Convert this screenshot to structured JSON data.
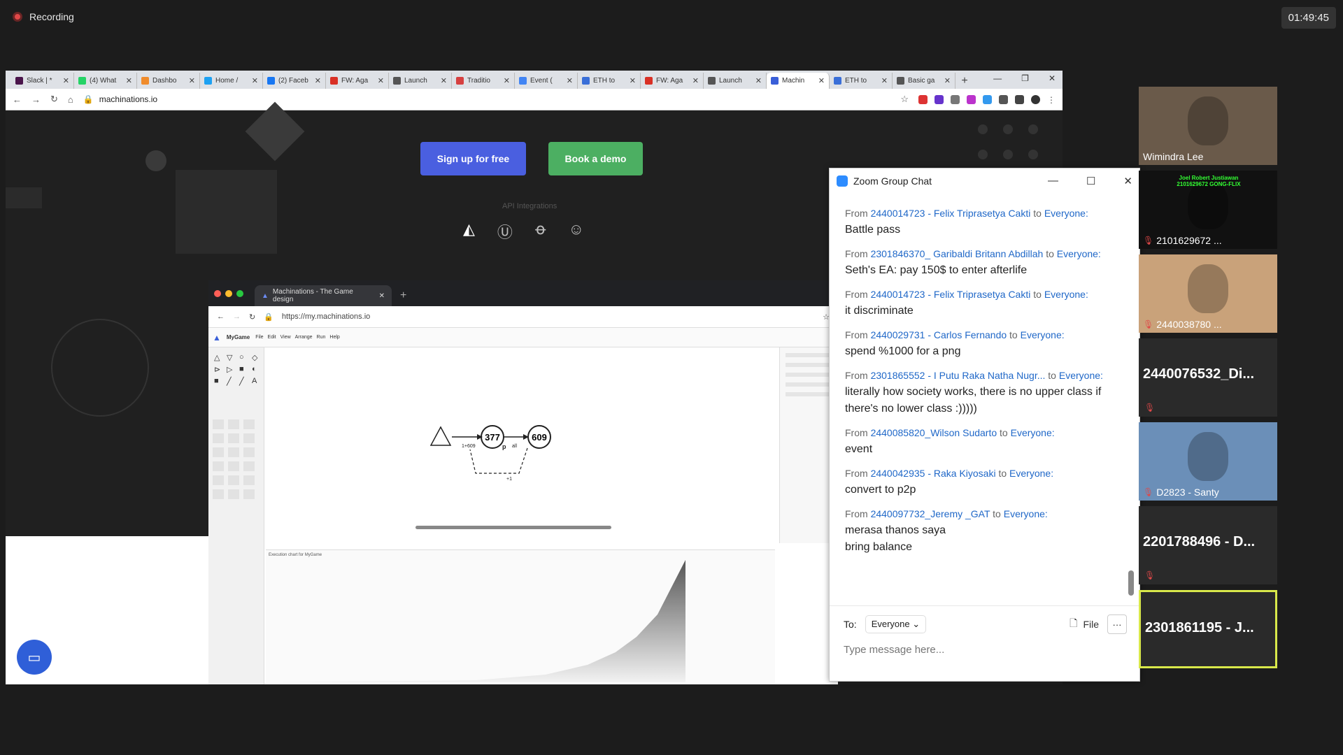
{
  "recording": {
    "label": "Recording"
  },
  "clock": "01:49:45",
  "browser": {
    "tabs": [
      {
        "label": "Slack | *",
        "color": "#4a154b"
      },
      {
        "label": "(4) What",
        "color": "#25d366"
      },
      {
        "label": "Dashbo",
        "color": "#f08c2c"
      },
      {
        "label": "Home /",
        "color": "#1da1f2"
      },
      {
        "label": "(2) Faceb",
        "color": "#1877f2"
      },
      {
        "label": "FW: Aga",
        "color": "#d93025"
      },
      {
        "label": "Launch",
        "color": "#555555"
      },
      {
        "label": "Traditio",
        "color": "#d64040"
      },
      {
        "label": "Event (",
        "color": "#4285f4"
      },
      {
        "label": "ETH to",
        "color": "#3a6fd8"
      },
      {
        "label": "FW: Aga",
        "color": "#d93025"
      },
      {
        "label": "Launch",
        "color": "#555555"
      },
      {
        "label": "Machin",
        "color": "#3a5fd8"
      },
      {
        "label": "ETH to",
        "color": "#3a6fd8"
      },
      {
        "label": "Basic ga",
        "color": "#555555"
      }
    ],
    "active_tab": 12,
    "url": "machinations.io"
  },
  "site": {
    "signup_label": "Sign up for free",
    "demo_label": "Book a demo",
    "api_label": "API Integrations"
  },
  "inner_browser": {
    "tab_title": "Machinations - The Game design",
    "url": "https://my.machinations.io",
    "diagram_title": "MyGame",
    "menu": [
      "File",
      "Edit",
      "View",
      "Arrange",
      "Run",
      "Help"
    ],
    "node_pool1": "377",
    "node_pool2": "609",
    "label_flow": "1+609",
    "label_p": "p",
    "label_all": "all",
    "label_plus1": "+1",
    "chart_title": "Execution chart for MyGame"
  },
  "zoom_chat": {
    "title": "Zoom Group Chat",
    "from_label": "From",
    "to_label": "to",
    "messages": [
      {
        "from": "2440014723 - Felix Triprasetya Cakti",
        "to": "Everyone:",
        "lines": [
          "Battle pass"
        ]
      },
      {
        "from": "2301846370_ Garibaldi Britann Abdillah",
        "to": "Everyone:",
        "lines": [
          "Seth's EA: pay 150$ to enter afterlife"
        ]
      },
      {
        "from": "2440014723 - Felix Triprasetya Cakti",
        "to": "Everyone:",
        "lines": [
          "it discriminate"
        ]
      },
      {
        "from": "2440029731 - Carlos Fernando",
        "to": "Everyone:",
        "lines": [
          "spend %1000 for a png"
        ]
      },
      {
        "from": "2301865552 - I Putu Raka Natha Nugr...",
        "to": "Everyone:",
        "lines": [
          "literally how society works, there is no upper class if there's no lower class :)))))"
        ]
      },
      {
        "from": "2440085820_Wilson Sudarto",
        "to": "Everyone:",
        "lines": [
          "event"
        ]
      },
      {
        "from": "2440042935 - Raka Kiyosaki",
        "to": "Everyone:",
        "lines": [
          "convert to p2p"
        ]
      },
      {
        "from": "2440097732_Jeremy _GAT",
        "to": "Everyone:",
        "lines": [
          "merasa thanos saya",
          "bring balance"
        ]
      }
    ],
    "to_field": "To:",
    "recipient": "Everyone",
    "file_label": "File",
    "more_label": "···",
    "input_placeholder": "Type message here..."
  },
  "participants": [
    {
      "name": "Wimindra Lee",
      "muted": false,
      "video": true,
      "bg": "#6a5a4a"
    },
    {
      "name": "2101629672 ...",
      "muted": true,
      "video": true,
      "bg": "#111111",
      "card_text": "Joel Robert Justiawan 2101629672 GONG-FLIX"
    },
    {
      "name": "2440038780 ...",
      "muted": true,
      "video": true,
      "bg": "#c9a27a"
    },
    {
      "name": "2440076532_Di...",
      "muted": true,
      "video": false
    },
    {
      "name": "D2823 - Santy",
      "muted": true,
      "video": true,
      "bg": "#6b8fb8"
    },
    {
      "name": "2201788496 - D...",
      "muted": true,
      "video": false
    },
    {
      "name": "2301861195 - J...",
      "muted": false,
      "video": false,
      "active": true
    }
  ]
}
